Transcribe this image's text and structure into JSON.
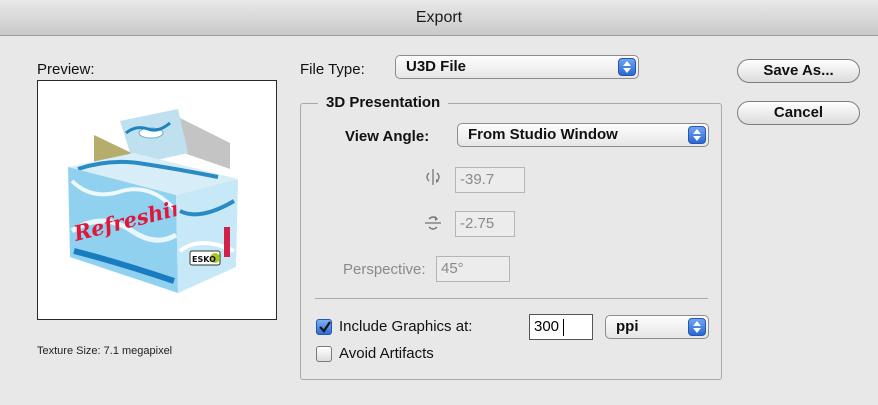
{
  "window": {
    "title": "Export"
  },
  "preview": {
    "label": "Preview:",
    "texture_size": "Texture Size: 7.1 megapixel"
  },
  "file_type": {
    "label": "File Type:",
    "value": "U3D File"
  },
  "buttons": {
    "save_as": "Save As...",
    "cancel": "Cancel"
  },
  "presentation": {
    "title": "3D Presentation",
    "view_angle_label": "View Angle:",
    "view_angle_value": "From Studio Window",
    "horizontal_rotation": "-39.7",
    "vertical_rotation": "-2.75",
    "perspective_label": "Perspective:",
    "perspective_value": "45°",
    "include_graphics_label": "Include Graphics at:",
    "include_graphics_checked": true,
    "resolution_value": "300",
    "resolution_unit": "ppi",
    "avoid_artifacts_label": "Avoid Artifacts",
    "avoid_artifacts_checked": false
  },
  "box_artwork": {
    "text": "Refreshing!",
    "logo_text": "ESKO"
  },
  "icons": {
    "horizontal_rotate": "rotate-horizontal-icon",
    "vertical_rotate": "rotate-vertical-icon",
    "popup_arrows": "updown-arrows-icon",
    "checkmark": "checkmark-icon"
  }
}
